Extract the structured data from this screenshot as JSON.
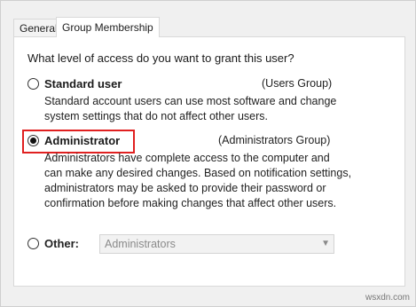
{
  "tabs": [
    "General",
    "Group Membership"
  ],
  "prompt": "What level of access do you want to grant this user?",
  "standard": {
    "label": "Standard user",
    "group": "(Users Group)",
    "description": [
      "Standard account users can use most software and change",
      "system settings that do not affect other users."
    ]
  },
  "admin": {
    "label": "Administrator",
    "group": "(Administrators Group)",
    "description": [
      "Administrators have complete access to the computer and",
      "can make any desired changes. Based on notification settings,",
      "administrators may be asked to provide their password or",
      "confirmation before making changes that affect other users."
    ]
  },
  "other": {
    "label": "Other:",
    "select_value": "Administrators"
  },
  "watermark": "wsxdn.com",
  "colors": {
    "highlight": "#e02020"
  }
}
